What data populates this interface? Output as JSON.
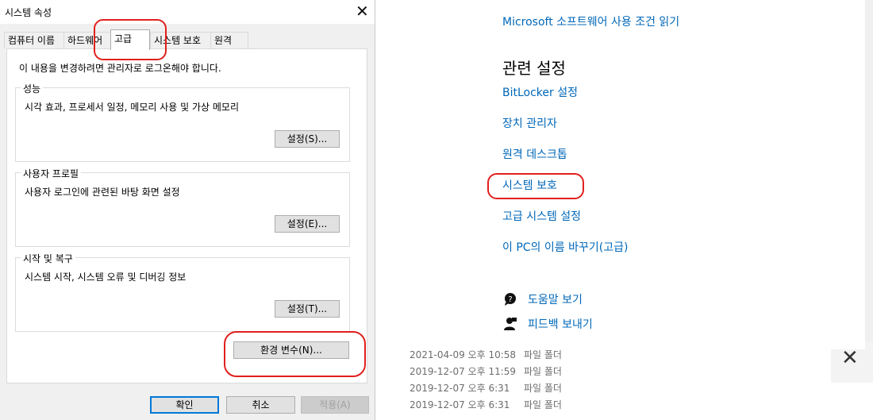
{
  "dialog": {
    "title": "시스템 속성",
    "close_glyph": "✕",
    "tabs": [
      "컴퓨터 이름",
      "하드웨어",
      "고급",
      "시스템 보호",
      "원격"
    ],
    "notice": "이 내용을 변경하려면 관리자로 로그온해야 합니다.",
    "groups": [
      {
        "label": "성능",
        "desc": "시각 효과, 프로세서 일정, 메모리 사용 및 가상 메모리",
        "button": "설정(S)..."
      },
      {
        "label": "사용자 프로필",
        "desc": "사용자 로그인에 관련된 바탕 화면 설정",
        "button": "설정(E)..."
      },
      {
        "label": "시작 및 복구",
        "desc": "시스템 시작, 시스템 오류 및 디버깅 정보",
        "button": "설정(T)..."
      }
    ],
    "env_button": "환경 변수(N)...",
    "ok_button": "확인",
    "cancel_button": "취소",
    "apply_button": "적용(A)"
  },
  "settings": {
    "terms_link": "Microsoft 소프트웨어 사용 조건 읽기",
    "related_heading": "관련 설정",
    "links": [
      "BitLocker 설정",
      "장치 관리자",
      "원격 데스크톱",
      "시스템 보호",
      "고급 시스템 설정",
      "이 PC의 이름 바꾸기(고급)"
    ],
    "help": "도움말 보기",
    "feedback": "피드백 보내기"
  },
  "explorer": {
    "rows": [
      {
        "date": "2021-04-09 오후 10:58",
        "type": "파일 폴더"
      },
      {
        "date": "2019-12-07 오후 11:59",
        "type": "파일 폴더"
      },
      {
        "date": "2019-12-07 오후 6:31",
        "type": "파일 폴더"
      },
      {
        "date": "2019-12-07 오후 6:31",
        "type": "파일 폴더"
      }
    ],
    "close_glyph": "✕"
  },
  "colors": {
    "link": "#0067b8",
    "highlight": "#e0201d",
    "accent": "#0078d7"
  }
}
